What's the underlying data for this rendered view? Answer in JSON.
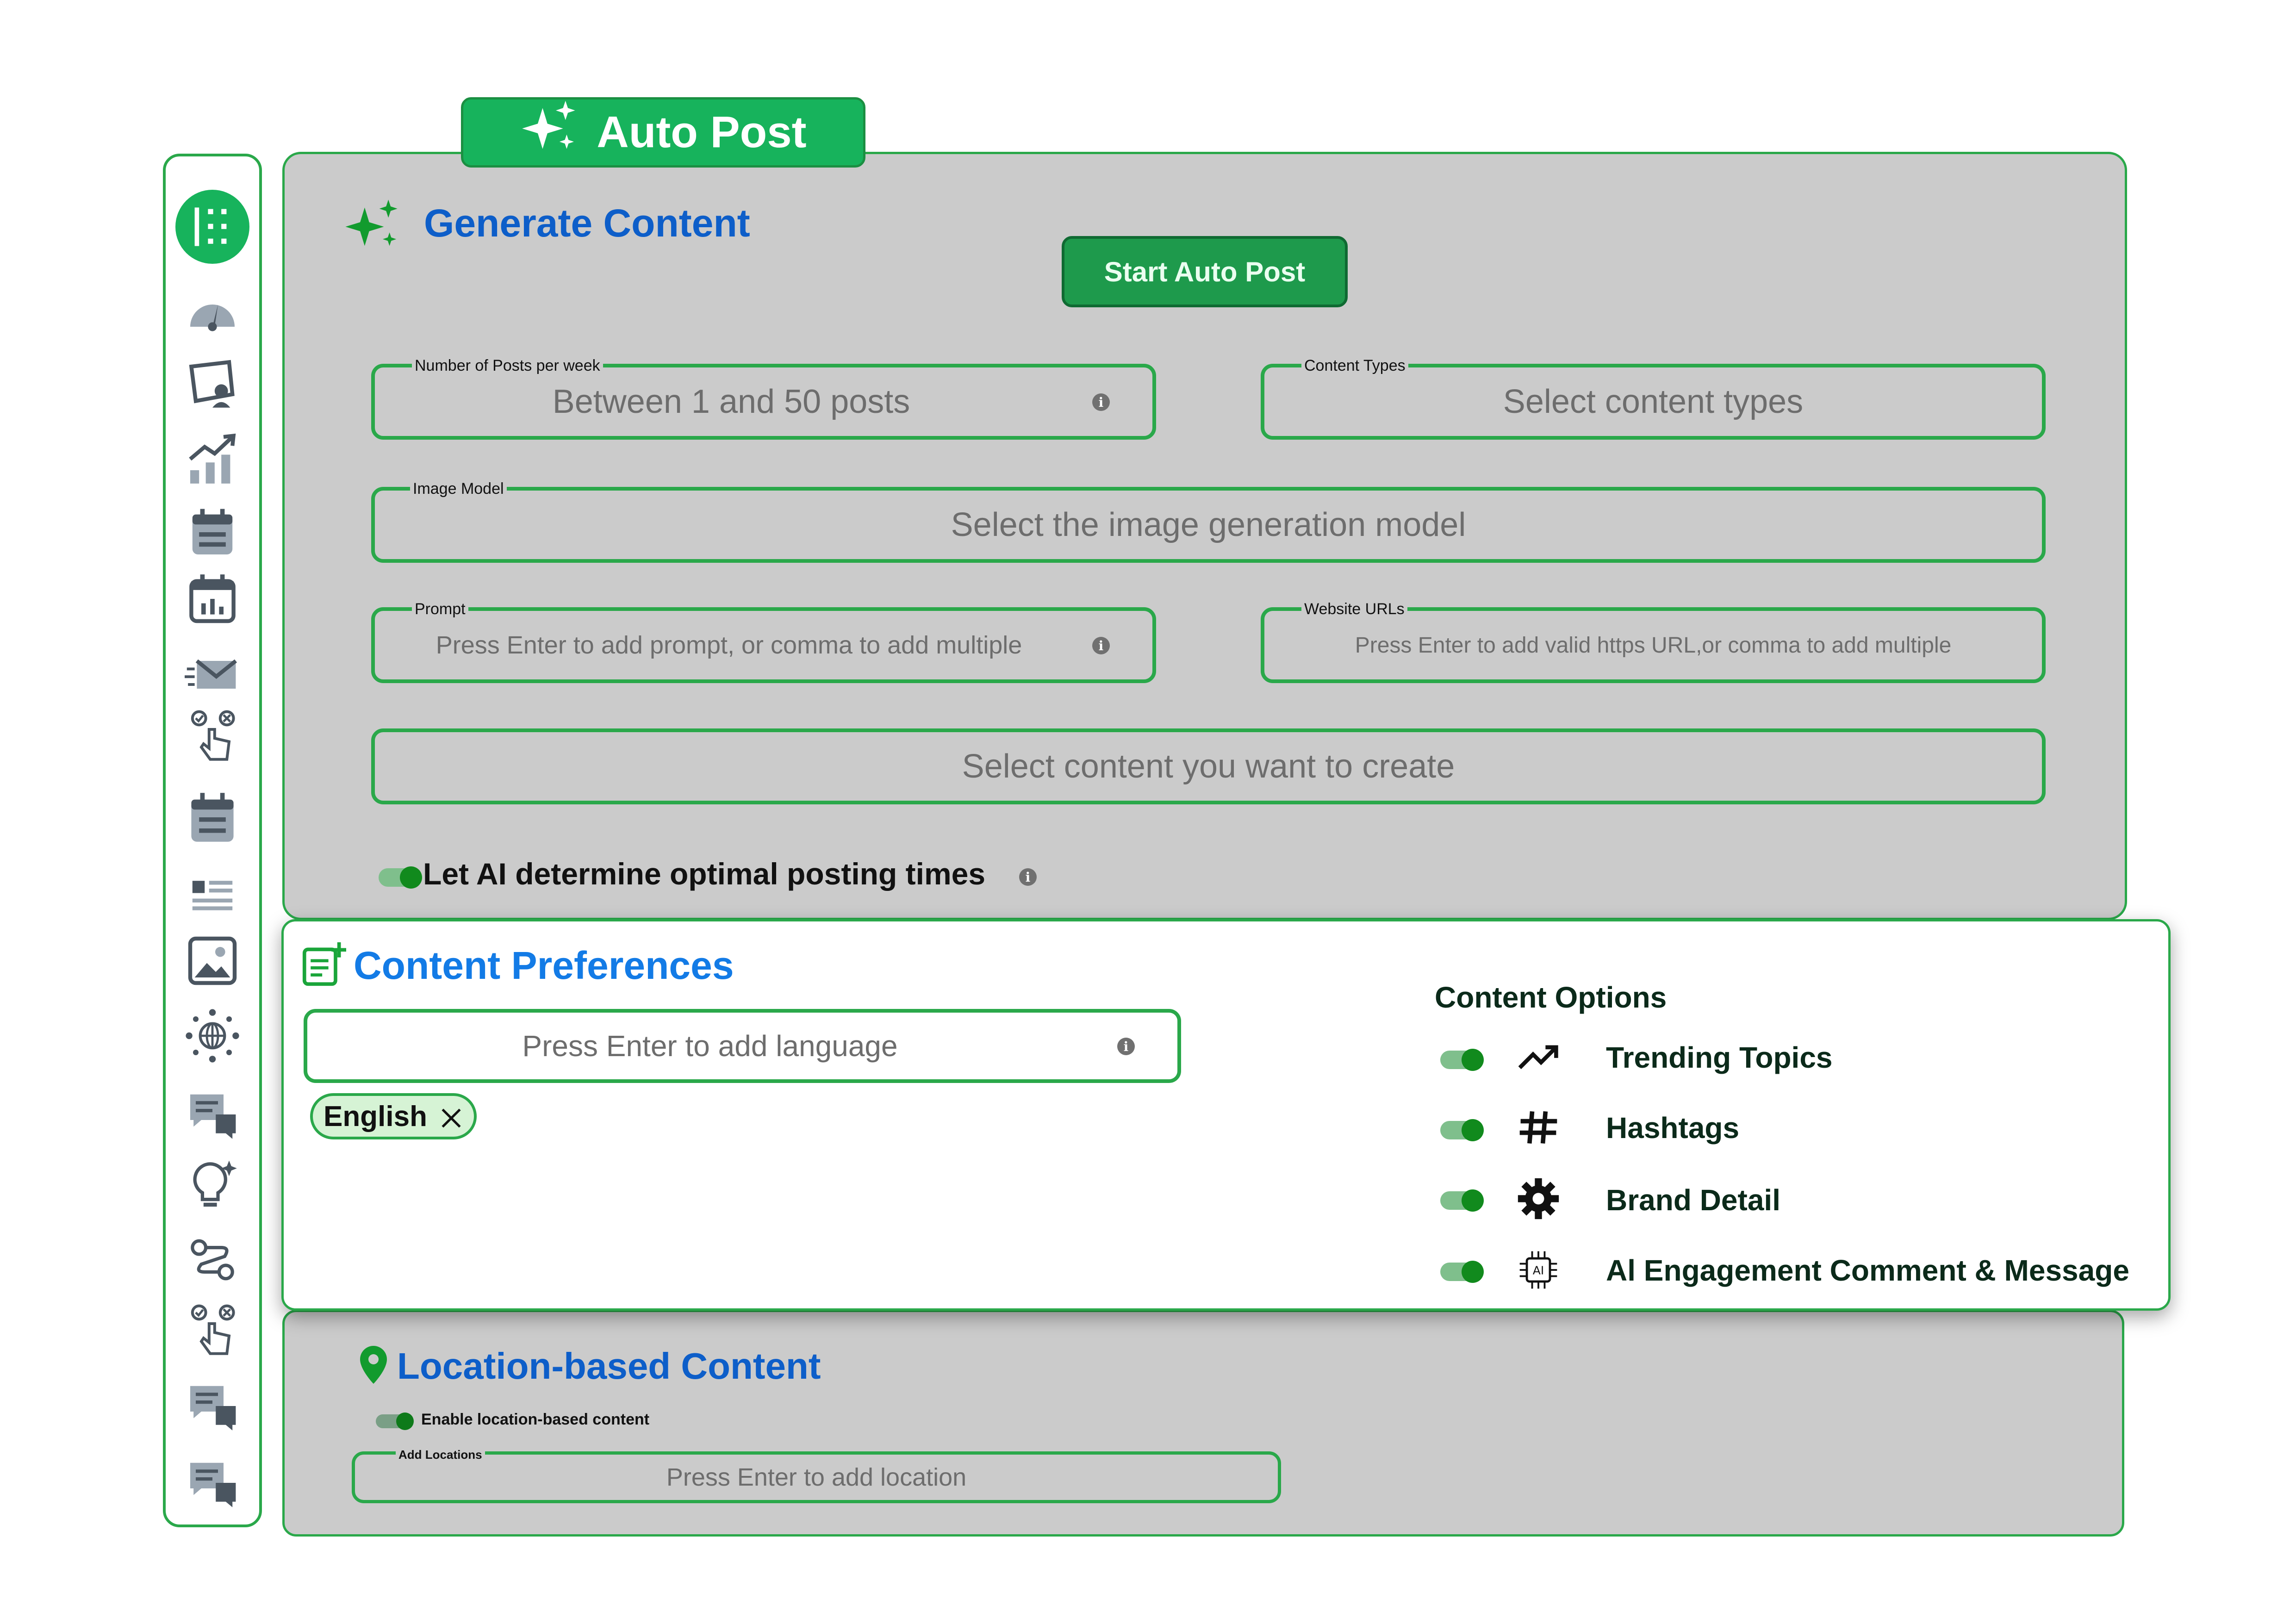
{
  "header": {
    "tab_label": "Auto Post"
  },
  "generate": {
    "title": "Generate Content",
    "start_button": "Start Auto Post",
    "posts_per_week": {
      "label": "Number of Posts per week",
      "placeholder": "Between 1 and 50 posts"
    },
    "content_types": {
      "label": "Content Types",
      "placeholder": "Select content types"
    },
    "image_model": {
      "label": "Image Model",
      "placeholder": "Select the image generation model"
    },
    "prompt": {
      "label": "Prompt",
      "placeholder": "Press Enter to add prompt, or comma to add multiple"
    },
    "website_urls": {
      "label": "Website URLs",
      "placeholder": "Press Enter to add valid https URL,or comma to add multiple"
    },
    "content_select": {
      "placeholder": "Select content you want to create"
    },
    "optimal_times": {
      "label": "Let AI determine optimal posting times",
      "enabled": true
    }
  },
  "preferences": {
    "title": "Content Preferences",
    "language": {
      "placeholder": "Press Enter to add language",
      "chips": [
        "English"
      ]
    },
    "options_title": "Content Options",
    "options": [
      {
        "label": "Trending Topics",
        "icon": "trending-up-icon",
        "enabled": true
      },
      {
        "label": "Hashtags",
        "icon": "hashtag-icon",
        "enabled": true
      },
      {
        "label": "Brand Detail",
        "icon": "gear-icon",
        "enabled": true
      },
      {
        "label": "Al Engagement Comment & Message",
        "icon": "ai-chip-icon",
        "enabled": true
      }
    ]
  },
  "location": {
    "title": "Location-based Content",
    "enable_label": "Enable location-based content",
    "enabled": true,
    "add_locations": {
      "label": "Add Locations",
      "placeholder": "Press Enter to add location"
    }
  },
  "sidebar": {
    "icons": [
      "grid-logo-icon",
      "dashboard-gauge-icon",
      "media-user-icon",
      "analytics-chart-icon",
      "calendar-list-icon",
      "calendar-icon",
      "email-send-icon",
      "touch-select-icon",
      "calendar-notes-icon",
      "list-icon",
      "image-edit-icon",
      "network-globe-icon",
      "chat-icon",
      "lightbulb-icon",
      "workflow-icon",
      "touch-select-icon",
      "chat-icon",
      "chat-icon"
    ]
  },
  "colors": {
    "brand_green": "#17b35c",
    "border_green": "#2aa84a",
    "title_blue": "#0d5ec9",
    "panel_gray": "#cbcbcb"
  }
}
